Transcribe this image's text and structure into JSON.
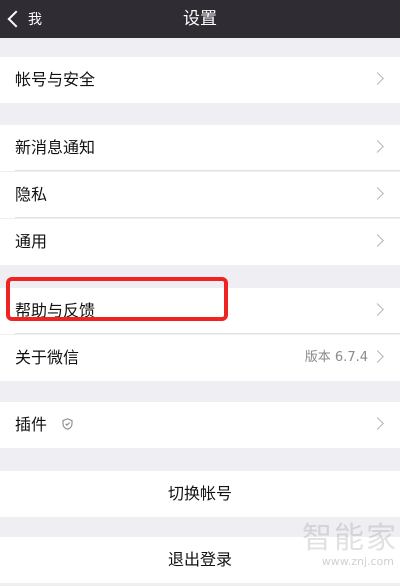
{
  "nav": {
    "back_label": "我",
    "title": "设置"
  },
  "rows": {
    "account_security": "帐号与安全",
    "new_message_notification": "新消息通知",
    "privacy": "隐私",
    "general": "通用",
    "help_feedback": "帮助与反馈",
    "about_wechat": "关于微信",
    "version": "版本 6.7.4",
    "plugins": "插件",
    "switch_account": "切换帐号",
    "logout": "退出登录"
  },
  "highlight_color": "#ef2321",
  "watermark": {
    "text_cn": "智能家",
    "url": "www.znj.com"
  }
}
